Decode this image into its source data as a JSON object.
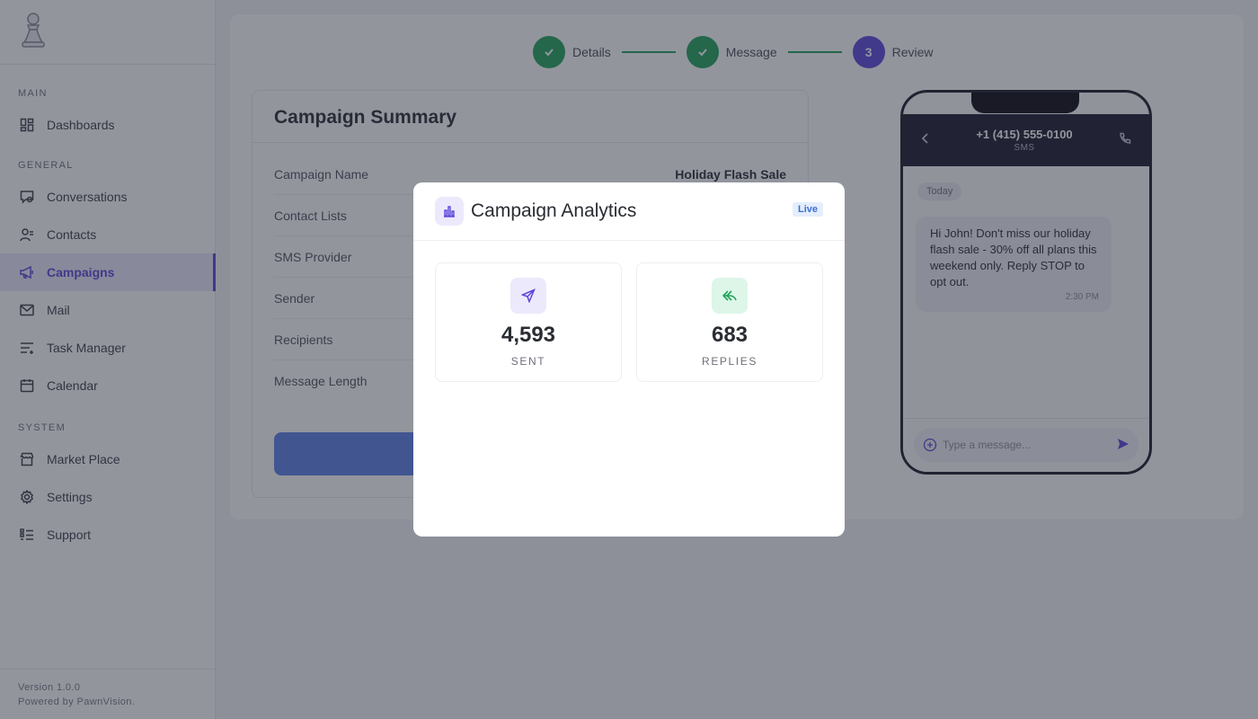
{
  "sidebar": {
    "logo_icon": "pawn-icon",
    "sections": [
      {
        "label": "MAIN",
        "items": [
          {
            "label": "Dashboards",
            "icon": "dashboard-icon"
          }
        ]
      },
      {
        "label": "GENERAL",
        "items": [
          {
            "label": "Conversations",
            "icon": "conversations-icon"
          },
          {
            "label": "Contacts",
            "icon": "contacts-icon"
          },
          {
            "label": "Campaigns",
            "icon": "megaphone-icon",
            "active": true
          },
          {
            "label": "Mail",
            "icon": "mail-icon"
          },
          {
            "label": "Task Manager",
            "icon": "task-list-icon"
          },
          {
            "label": "Calendar",
            "icon": "calendar-icon"
          }
        ]
      },
      {
        "label": "SYSTEM",
        "items": [
          {
            "label": "Market Place",
            "icon": "store-icon"
          },
          {
            "label": "Settings",
            "icon": "gear-icon"
          },
          {
            "label": "Support",
            "icon": "support-icon"
          }
        ]
      }
    ],
    "footer": {
      "version": "Version 1.0.0",
      "powered_by": "Powered by PawnVision."
    }
  },
  "stepper": {
    "steps": [
      {
        "label": "Details",
        "state": "done"
      },
      {
        "label": "Message",
        "state": "done"
      },
      {
        "label": "Review",
        "number": "3",
        "state": "current"
      }
    ]
  },
  "summary": {
    "title": "Campaign Summary",
    "rows": [
      {
        "label": "Campaign Name",
        "value": "Holiday Flash Sale"
      },
      {
        "label": "Contact Lists",
        "value": ""
      },
      {
        "label": "SMS Provider",
        "value": ""
      },
      {
        "label": "Sender",
        "value": ""
      },
      {
        "label": "Recipients",
        "value": ""
      },
      {
        "label": "Message Length",
        "value": ""
      }
    ]
  },
  "phone": {
    "number": "+1 (415) 555-0100",
    "channel": "SMS",
    "day_chip": "Today",
    "message": "Hi John! Don't miss our holiday flash sale - 30% off all plans this weekend only. Reply STOP to opt out.",
    "message_time": "2:30 PM",
    "compose_placeholder": "Type a message..."
  },
  "modal": {
    "title": "Campaign Analytics",
    "badge": "Live",
    "icon": "bar-chart-icon",
    "stats": [
      {
        "value": "4,593",
        "label": "SENT",
        "icon": "send-icon",
        "color": "#5b46d9"
      },
      {
        "value": "683",
        "label": "REPLIES",
        "icon": "reply-icon",
        "color": "#21a35a"
      }
    ]
  },
  "colors": {
    "accent": "#5b46d9",
    "success": "#21a35a",
    "primary_button": "#5b7fe6"
  }
}
